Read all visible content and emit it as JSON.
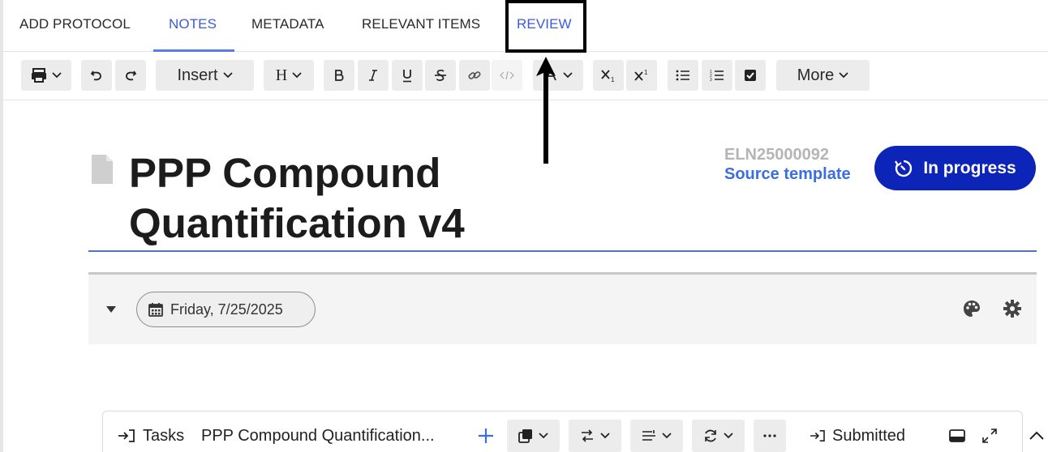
{
  "tabs": [
    {
      "label": "ADD PROTOCOL",
      "active": false
    },
    {
      "label": "NOTES",
      "active": true
    },
    {
      "label": "METADATA",
      "active": false
    },
    {
      "label": "RELEVANT ITEMS",
      "active": false
    },
    {
      "label": "REVIEW",
      "active": false,
      "highlighted": true
    }
  ],
  "toolbar": {
    "insert_label": "Insert",
    "heading_label": "H",
    "more_label": "More",
    "buttons": [
      "print-icon",
      "undo-icon",
      "redo-icon",
      "bold-icon",
      "italic-icon",
      "underline-icon",
      "strikethrough-icon",
      "link-icon",
      "code-icon",
      "text-color-icon",
      "subscript-icon",
      "superscript-icon",
      "bullet-list-icon",
      "numbered-list-icon",
      "checkbox-icon"
    ]
  },
  "document": {
    "title": "PPP Compound Quantification v4",
    "eln_id": "ELN25000092",
    "source_link": "Source template",
    "status": "In progress"
  },
  "section": {
    "date": "Friday, 7/25/2025"
  },
  "taskbar": {
    "tasks_label": "Tasks",
    "task_name": "PPP Compound Quantification...",
    "submitted_label": "Submitted"
  },
  "colors": {
    "accent": "#3b5bdb",
    "status_bg": "#0d24b8",
    "link": "#3b6ee0",
    "id_gray": "#b5b5b5",
    "annotation": "#000000"
  }
}
